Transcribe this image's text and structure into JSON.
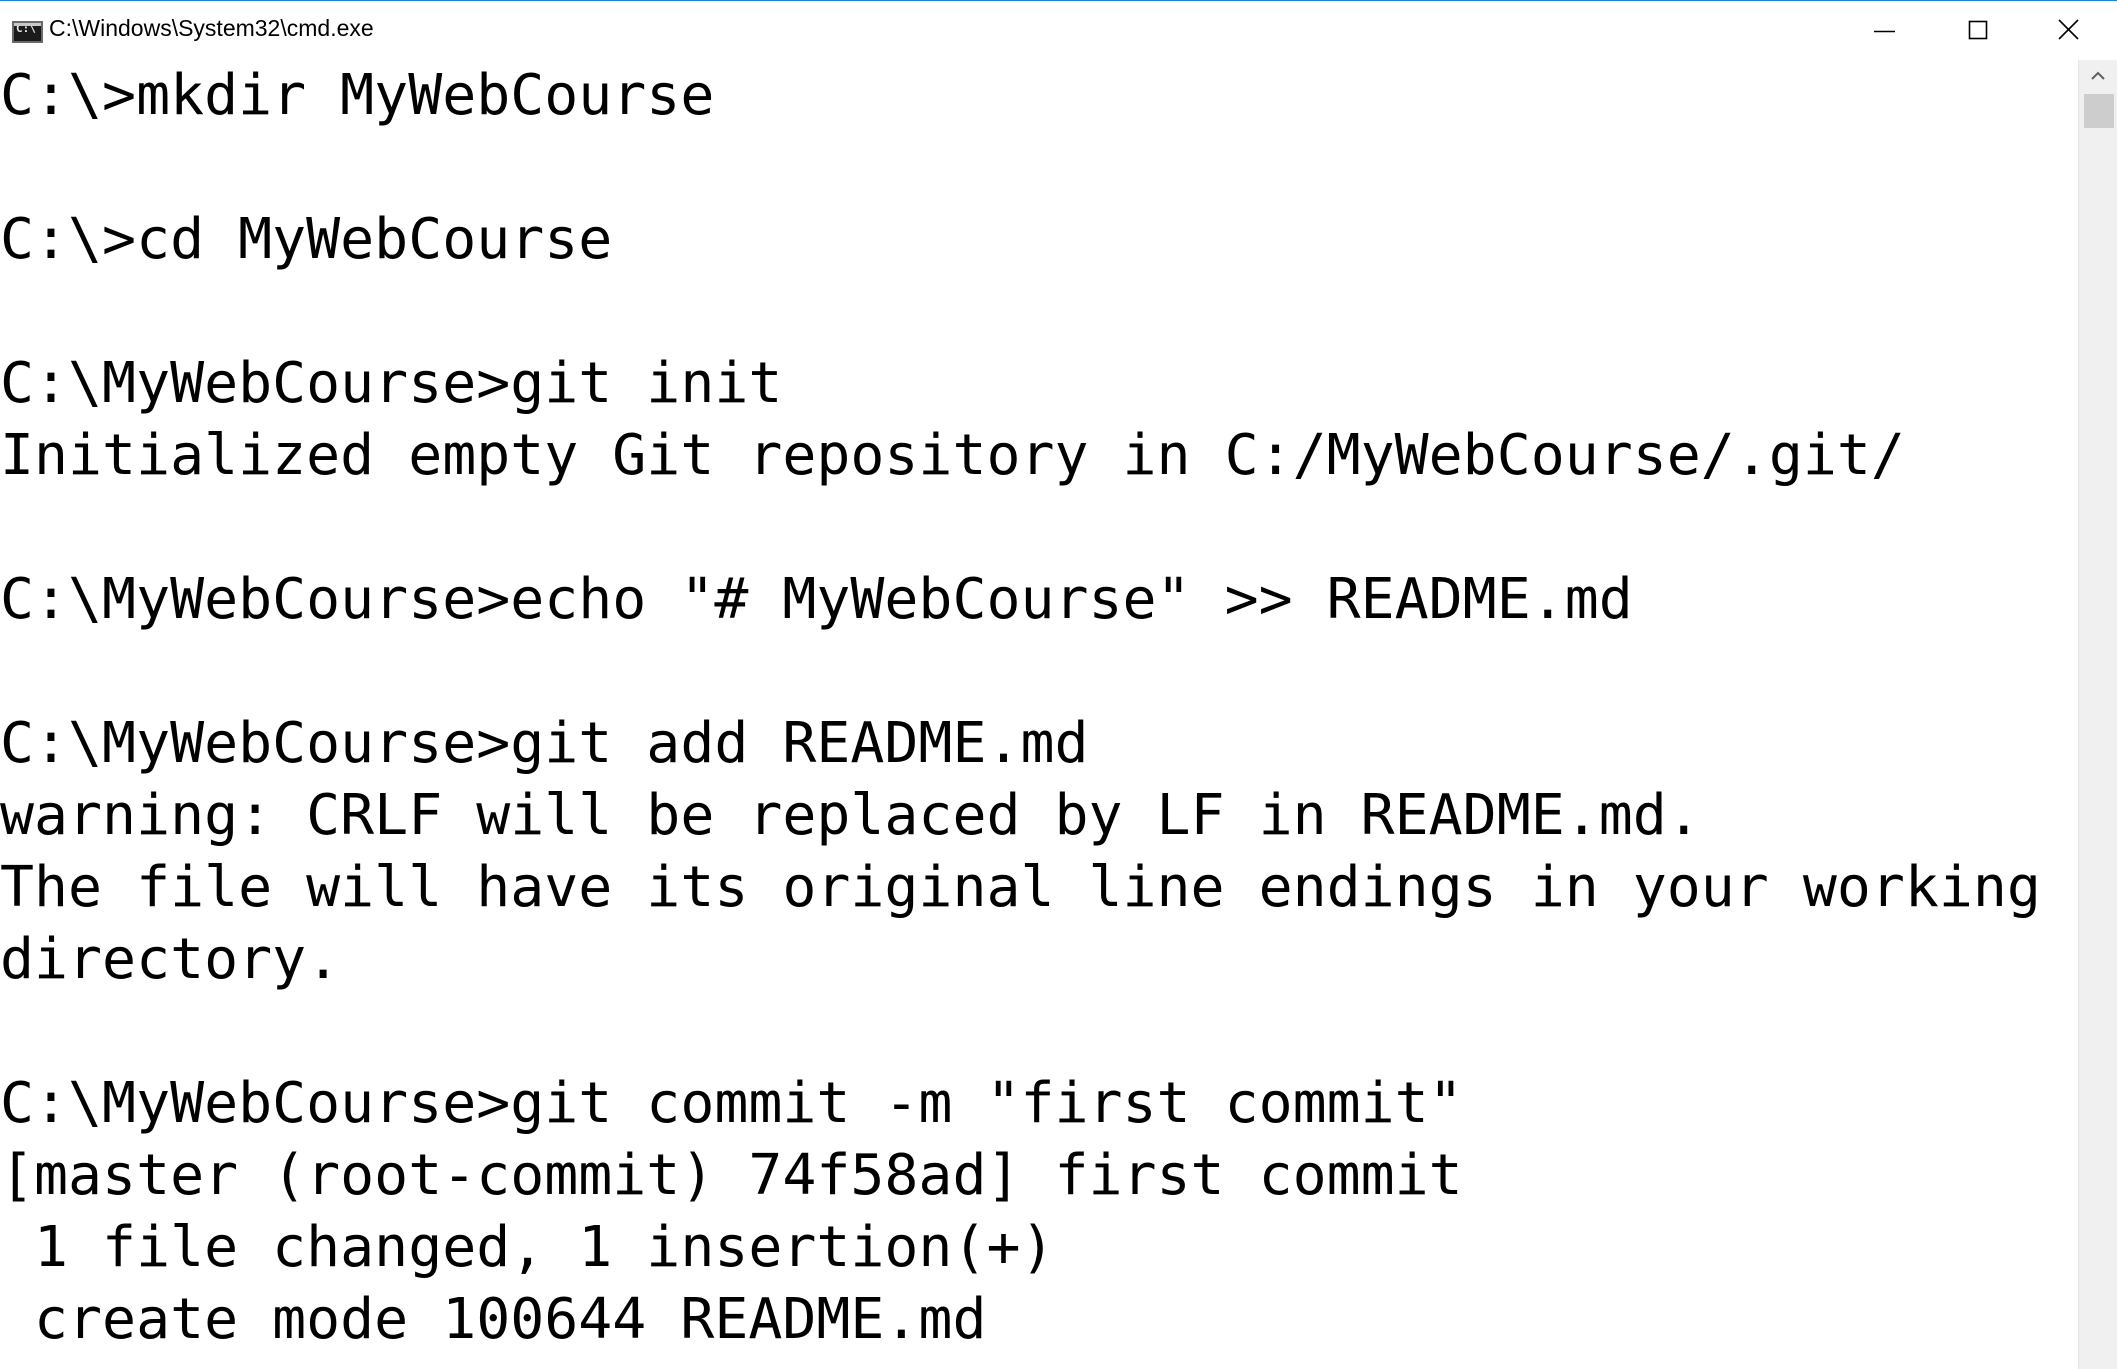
{
  "window": {
    "title": "C:\\Windows\\System32\\cmd.exe",
    "icon": "cmd-console-icon",
    "icon_label": "C:\\",
    "controls": {
      "minimize": "minimize-icon",
      "maximize": "maximize-icon",
      "close": "close-icon"
    }
  },
  "console": {
    "lines": [
      "C:\\>mkdir MyWebCourse",
      "",
      "C:\\>cd MyWebCourse",
      "",
      "C:\\MyWebCourse>git init",
      "Initialized empty Git repository in C:/MyWebCourse/.git/",
      "",
      "C:\\MyWebCourse>echo \"# MyWebCourse\" >> README.md",
      "",
      "C:\\MyWebCourse>git add README.md",
      "warning: CRLF will be replaced by LF in README.md.",
      "The file will have its original line endings in your working",
      "directory.",
      "",
      "C:\\MyWebCourse>git commit -m \"first commit\"",
      "[master (root-commit) 74f58ad] first commit",
      " 1 file changed, 1 insertion(+)",
      " create mode 100644 README.md"
    ]
  },
  "scrollbar": {
    "up_arrow": "chevron-up-icon"
  },
  "colors": {
    "background": "#ffffff",
    "text": "#000000",
    "window_border": "#1883d7",
    "scrollbar_track": "#f0f0f0",
    "scrollbar_thumb": "#cdcdcd"
  }
}
